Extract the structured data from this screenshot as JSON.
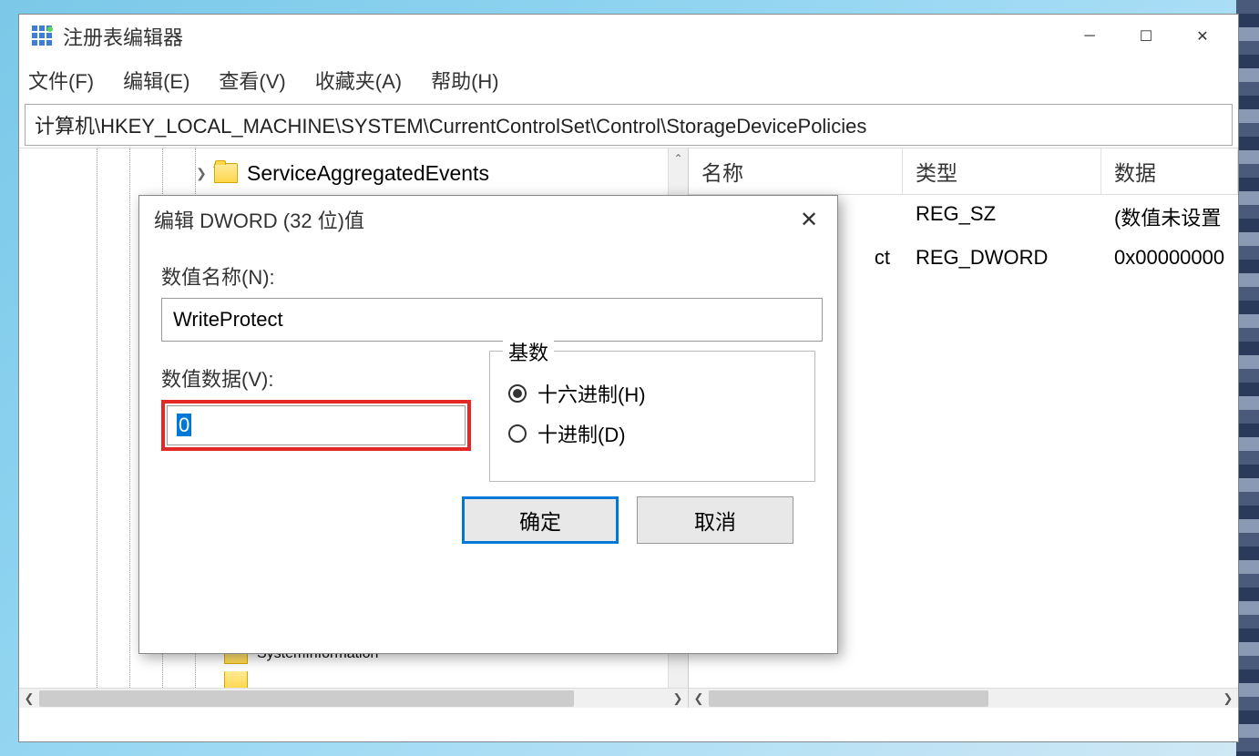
{
  "window": {
    "title": "注册表编辑器"
  },
  "menu": {
    "file": "文件(F)",
    "edit": "编辑(E)",
    "view": "查看(V)",
    "favorites": "收藏夹(A)",
    "help": "帮助(H)"
  },
  "address": "计算机\\HKEY_LOCAL_MACHINE\\SYSTEM\\CurrentControlSet\\Control\\StorageDevicePolicies",
  "tree": {
    "visible_top": "ServiceAggregatedEvents",
    "visible_bottom": "SystemInformation"
  },
  "list": {
    "headers": {
      "name": "名称",
      "type": "类型",
      "data": "数据"
    },
    "rows": [
      {
        "name": "",
        "type": "REG_SZ",
        "data": "(数值未设置"
      },
      {
        "name": "ct",
        "type": "REG_DWORD",
        "data": "0x00000000"
      }
    ]
  },
  "dialog": {
    "title": "编辑 DWORD (32 位)值",
    "name_label": "数值名称(N):",
    "name_value": "WriteProtect",
    "data_label": "数值数据(V):",
    "data_value": "0",
    "radix_label": "基数",
    "radix_hex": "十六进制(H)",
    "radix_dec": "十进制(D)",
    "ok": "确定",
    "cancel": "取消"
  }
}
